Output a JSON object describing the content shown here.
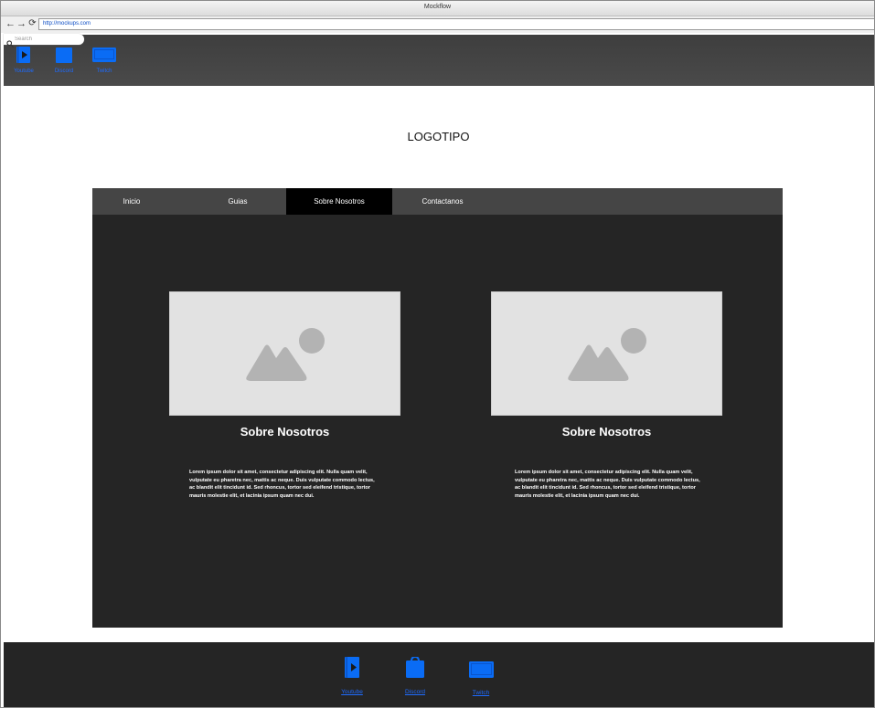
{
  "window": {
    "title": "Mockflow"
  },
  "browser": {
    "url": "http://mockups.com"
  },
  "search": {
    "placeholder": "Search"
  },
  "top_links": [
    {
      "label": "Youtube",
      "icon": "youtube-icon"
    },
    {
      "label": "Discord",
      "icon": "discord-icon"
    },
    {
      "label": "Twitch",
      "icon": "twitch-icon"
    }
  ],
  "logo": "LOGOTIPO",
  "nav": {
    "tabs": [
      "Inicio",
      "Guias",
      "Sobre Nosotros",
      "Contactanos"
    ],
    "active": "Sobre Nosotros"
  },
  "cards": [
    {
      "title": "Sobre Nosotros",
      "text": "Lorem ipsum dolor sit amet, consectetur adipiscing elit. Nulla quam velit, vulputate eu pharetra nec, mattis ac neque. Duis vulputate commodo lectus, ac blandit elit tincidunt id. Sed rhoncus, tortor sed eleifend tristique, tortor mauris molestie elit, et lacinia ipsum quam nec dui."
    },
    {
      "title": "Sobre Nosotros",
      "text": "Lorem ipsum dolor sit amet, consectetur adipiscing elit. Nulla quam velit, vulputate eu pharetra nec, mattis ac neque. Duis vulputate commodo lectus, ac blandit elit tincidunt id. Sed rhoncus, tortor sed eleifend tristique, tortor mauris molestie elit, et lacinia ipsum quam nec dui."
    }
  ],
  "footer_links": [
    {
      "label": "Youtube",
      "icon": "youtube-icon"
    },
    {
      "label": "Discord",
      "icon": "discord-icon"
    },
    {
      "label": "Twitch",
      "icon": "twitch-icon"
    }
  ],
  "colors": {
    "link_blue": "#1e6bff",
    "icon_blue": "#0a6cf5",
    "dark_bg": "#252525",
    "nav_bg": "#454545",
    "active_tab": "#000000",
    "placeholder_bg": "#e2e2e2",
    "placeholder_shape": "#b3b3b3"
  }
}
